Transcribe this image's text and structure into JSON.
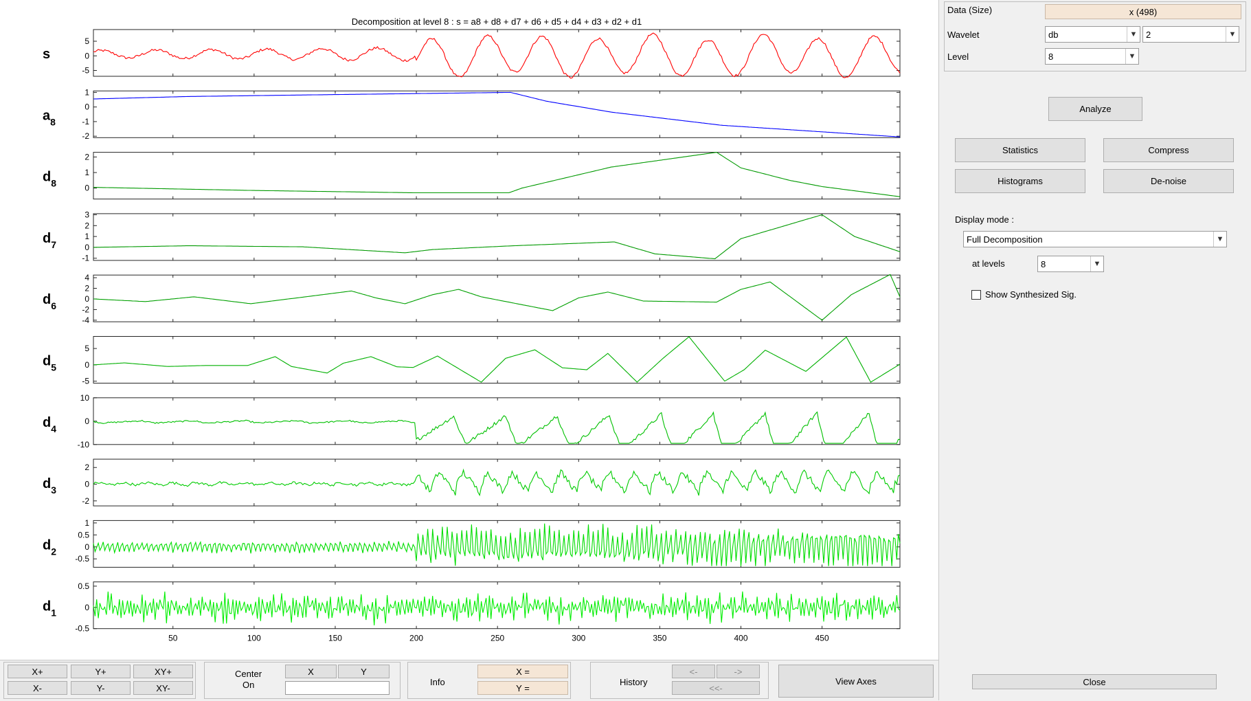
{
  "plot": {
    "title": "Decomposition at level 8 : s = a8 + d8 + d7 + d6 + d5 + d4 + d3 + d2 + d1",
    "x_ticks": [
      50,
      100,
      150,
      200,
      250,
      300,
      350,
      400,
      450
    ],
    "rows": [
      {
        "base": "s",
        "sub": "",
        "ticks": [
          "5",
          "0",
          "-5"
        ],
        "tickvals": [
          5,
          0,
          -5
        ],
        "ylim": [
          -7,
          9
        ],
        "color": "#ff0000",
        "kind": "signal"
      },
      {
        "base": "a",
        "sub": "8",
        "ticks": [
          "1",
          "0",
          "-1",
          "-2"
        ],
        "tickvals": [
          1,
          0,
          -1,
          -2
        ],
        "ylim": [
          -2.1,
          1.1
        ],
        "color": "#0000ff",
        "kind": "approx"
      },
      {
        "base": "d",
        "sub": "8",
        "ticks": [
          "2",
          "1",
          "0"
        ],
        "tickvals": [
          2,
          1,
          0
        ],
        "ylim": [
          -0.7,
          2.3
        ],
        "color": "#009900",
        "kind": "d8"
      },
      {
        "base": "d",
        "sub": "7",
        "ticks": [
          "3",
          "2",
          "1",
          "0",
          "-1"
        ],
        "tickvals": [
          3,
          2,
          1,
          0,
          -1
        ],
        "ylim": [
          -1.2,
          3.1
        ],
        "color": "#009900",
        "kind": "d7"
      },
      {
        "base": "d",
        "sub": "6",
        "ticks": [
          "4",
          "2",
          "0",
          "-2",
          "-4"
        ],
        "tickvals": [
          4,
          2,
          0,
          -2,
          -4
        ],
        "ylim": [
          -4.3,
          4.5
        ],
        "color": "#00a000",
        "kind": "d6"
      },
      {
        "base": "d",
        "sub": "5",
        "ticks": [
          "5",
          "0",
          "-5"
        ],
        "tickvals": [
          5,
          0,
          -5
        ],
        "ylim": [
          -5.6,
          8.7
        ],
        "color": "#00b000",
        "kind": "d5"
      },
      {
        "base": "d",
        "sub": "4",
        "ticks": [
          "10",
          "0",
          "-10"
        ],
        "tickvals": [
          10,
          0,
          -10
        ],
        "ylim": [
          -10,
          10
        ],
        "color": "#00c000",
        "kind": "d4"
      },
      {
        "base": "d",
        "sub": "3",
        "ticks": [
          "2",
          "0",
          "-2"
        ],
        "tickvals": [
          2,
          0,
          -2
        ],
        "ylim": [
          -2.6,
          3.0
        ],
        "color": "#00cc00",
        "kind": "d3"
      },
      {
        "base": "d",
        "sub": "2",
        "ticks": [
          "1",
          "0.5",
          "0",
          "-0.5"
        ],
        "tickvals": [
          1,
          0.5,
          0,
          -0.5
        ],
        "ylim": [
          -0.85,
          1.1
        ],
        "color": "#00dd00",
        "kind": "d2"
      },
      {
        "base": "d",
        "sub": "1",
        "ticks": [
          "0.5",
          "0",
          "-0.5"
        ],
        "tickvals": [
          0.5,
          0,
          -0.5
        ],
        "ylim": [
          -0.5,
          0.6
        ],
        "color": "#00ee00",
        "kind": "d1"
      }
    ]
  },
  "right_panel": {
    "data_label": "Data  (Size)",
    "data_value": "x  (498)",
    "wavelet_label": "Wavelet",
    "wavelet_family": "db",
    "wavelet_order": "2",
    "level_label": "Level",
    "level_value": "8",
    "analyze": "Analyze",
    "statistics": "Statistics",
    "compress": "Compress",
    "histograms": "Histograms",
    "denoise": "De-noise",
    "display_mode_label": "Display mode :",
    "display_mode_value": "Full Decomposition",
    "at_levels_label": "at levels",
    "at_levels_value": "8",
    "show_synth": "Show Synthesized Sig.",
    "show_synth_checked": false,
    "close": "Close"
  },
  "bottom_bar": {
    "xplus": "X+",
    "yplus": "Y+",
    "xyplus": "XY+",
    "xminus": "X-",
    "yminus": "Y-",
    "xyminus": "XY-",
    "center_label": "Center",
    "on_label": "On",
    "center_x": "X",
    "center_y": "Y",
    "info_label": "Info",
    "x_eq": "X =",
    "y_eq": "Y =",
    "history_label": "History",
    "hist_back": "<-",
    "hist_fwd": "->",
    "hist_first": "<<-",
    "view_axes": "View Axes"
  }
}
